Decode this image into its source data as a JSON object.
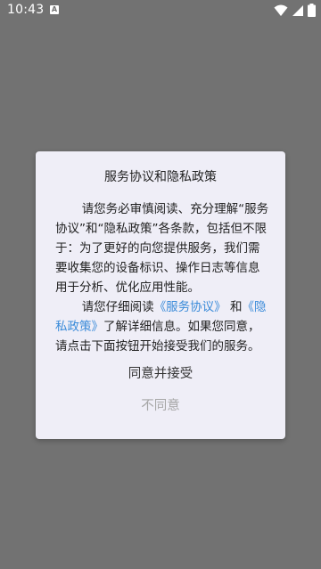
{
  "status_bar": {
    "time": "10:43",
    "notification_icon": "A",
    "icons": [
      "wifi-icon",
      "signal-icon",
      "battery-icon"
    ]
  },
  "dialog": {
    "title": "服务协议和隐私政策",
    "para1": "请您务必审慎阅读、充分理解“服务协议”和“隐私政策”各条款，包括但不限于：为了更好的向您提供服务，我们需要收集您的设备标识、操作日志等信息用于分析、优化应用性能。",
    "para2_prefix": "请您仔细阅读",
    "link_service": "《服务协议》",
    "para2_and": "和",
    "link_privacy": "《隐私政策》",
    "para2_suffix": "了解详细信息。如果您同意，请点击下面按钮开始接受我们的服务。",
    "agree_label": "同意并接受",
    "disagree_label": "不同意"
  },
  "colors": {
    "background_overlay": "#727272",
    "dialog_background": "#efeef7",
    "link": "#3a8bd9",
    "disabled_text": "#a6a6a6"
  }
}
